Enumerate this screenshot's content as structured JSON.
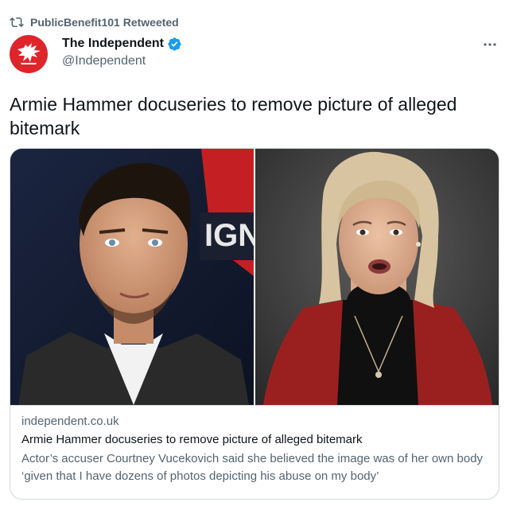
{
  "retweet": {
    "icon": "retweet-icon",
    "text": "PublicBenefit101 Retweeted"
  },
  "author": {
    "avatar_icon": "independent-eagle-logo",
    "avatar_color": "#e0242b",
    "name": "The Independent",
    "verified_icon": "verified-badge-icon",
    "verified_color": "#1d9bf0",
    "handle": "@Independent"
  },
  "more_icon": "more-options-icon",
  "tweet": {
    "text": "Armie Hammer docuseries to remove picture of alleged bitemark"
  },
  "card": {
    "left_image": "man-in-suit-photo",
    "right_image": "woman-speaking-photo",
    "domain": "independent.co.uk",
    "title": "Armie Hammer docuseries to remove picture of alleged bitemark",
    "description": "Actor’s accuser Courtney Vucekovich said she believed the image was of her own body ‘given that I have dozens of photos depicting his abuse on my body’"
  },
  "colors": {
    "text_primary": "#0f1419",
    "text_secondary": "#536471",
    "border": "#cfd9de"
  }
}
